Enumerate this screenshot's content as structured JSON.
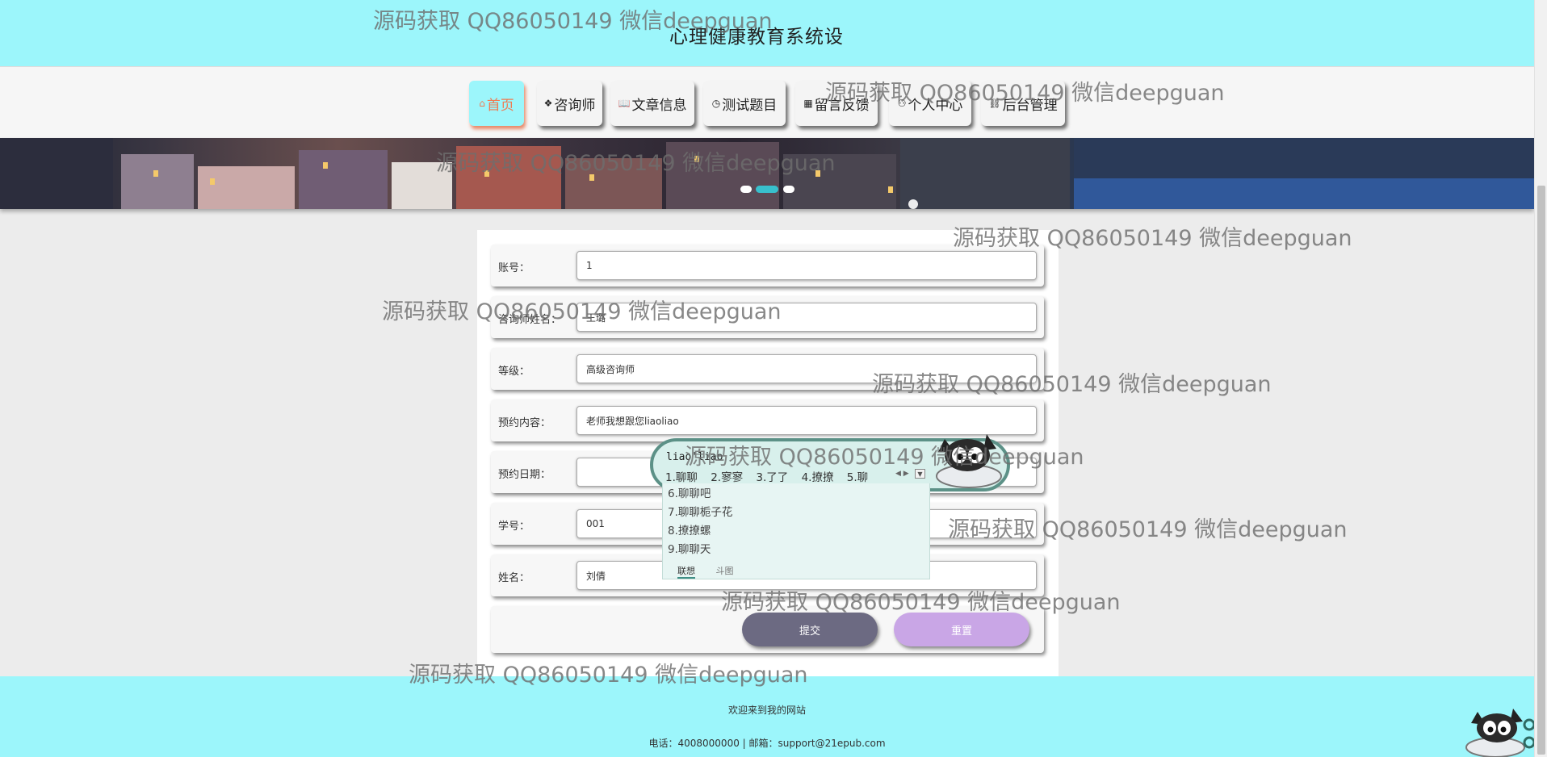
{
  "header": {
    "title": "心理健康教育系统设"
  },
  "nav": {
    "items": [
      {
        "label": "首页",
        "icon": "⌂"
      },
      {
        "label": "咨询师",
        "icon": "❖"
      },
      {
        "label": "文章信息",
        "icon": "📖"
      },
      {
        "label": "测试题目",
        "icon": "◷"
      },
      {
        "label": "留言反馈",
        "icon": "▦"
      },
      {
        "label": "个人中心",
        "icon": "⚇"
      },
      {
        "label": "后台管理",
        "icon": "⛓"
      }
    ],
    "active_color": "#f07a52",
    "header_bg": "#9cf6fb"
  },
  "carousel": {
    "slides": 3,
    "active": 2
  },
  "form": {
    "fields": [
      {
        "label": "账号：",
        "value": "1"
      },
      {
        "label": "咨询师姓名：",
        "value": "王璐"
      },
      {
        "label": "等级：",
        "value": "高级咨询师"
      },
      {
        "label": "预约内容：",
        "value": "老师我想跟您liaoliao"
      },
      {
        "label": "预约日期：",
        "value": ""
      },
      {
        "label": "学号：",
        "value": "001"
      },
      {
        "label": "姓名：",
        "value": "刘倩"
      }
    ],
    "submit_label": "提交",
    "reset_label": "重置"
  },
  "ime": {
    "pinyin": "liao'liao",
    "candidates_row": [
      "1.聊聊",
      "2.寥寥",
      "3.了了",
      "4.撩撩",
      "5.聊"
    ],
    "candidates_more": [
      "6.聊聊吧",
      "7.聊聊栀子花",
      "8.撩撩螺",
      "9.聊聊天"
    ],
    "tabs": [
      "联想",
      "斗图"
    ]
  },
  "footer": {
    "welcome": "欢迎来到我的网站",
    "contact": "电话：4008000000 | 邮箱：support@21epub.com"
  },
  "watermark": "源码获取 QQ86050149 微信deepguan"
}
